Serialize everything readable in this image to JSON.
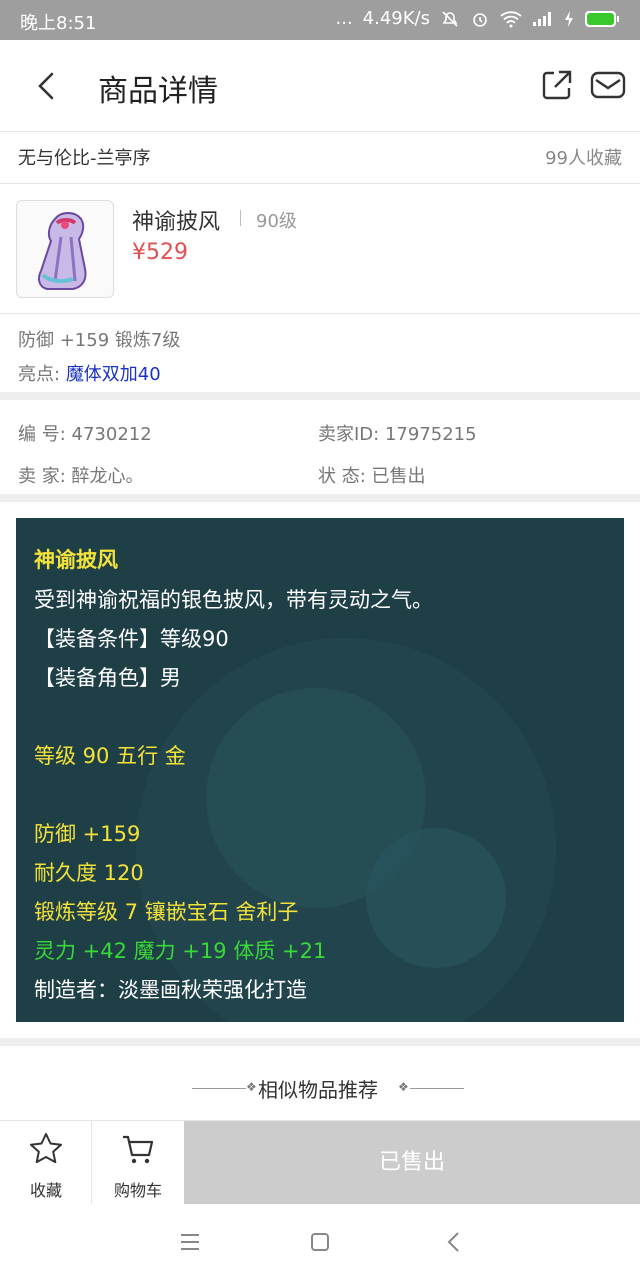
{
  "status_bar": {
    "time": "晚上8:51",
    "dots": "...",
    "speed": "4.49K/s"
  },
  "nav": {
    "title": "商品详情",
    "icons": [
      "back-icon",
      "share-icon",
      "mail-icon"
    ]
  },
  "product": {
    "name": "无与伦比-兰亭序",
    "fav_count": "99人收藏",
    "title": "神谕披风",
    "level": "90级",
    "price": "¥529",
    "attrs": "防御 +159 锻炼7级",
    "highlight_label": "亮点:",
    "highlight_value": "魔体双加40"
  },
  "meta": {
    "id_label": "编  号:",
    "id_value": "4730212",
    "seller_id_label": "卖家ID:",
    "seller_id_value": "17975215",
    "seller_label": "卖  家:",
    "seller_value": "醉龙心。",
    "status_label": "状  态:",
    "status_value": "已售出"
  },
  "description": {
    "title": "神谕披风",
    "line1": "受到神谕祝福的银色披风，带有灵动之气。",
    "line2": "【装备条件】等级90",
    "line3": "【装备角色】男",
    "line4": "等级 90  五行 金",
    "line5": "防御 +159",
    "line6": "耐久度 120",
    "line7": "锻炼等级 7  镶嵌宝石 舍利子",
    "line8": "灵力 +42 魔力 +19 体质 +21",
    "line9": "制造者：淡墨画秋荣强化打造"
  },
  "similar": {
    "label": "相似物品推荐"
  },
  "bottom_bar": {
    "fav_label": "收藏",
    "cart_label": "购物车",
    "sold_label": "已售出"
  },
  "colors": {
    "price": "#e05050",
    "highlight": "#1a33c4",
    "panel_bg": "#1f3f47",
    "text_yellow": "#f2e23a",
    "text_green": "#38d838",
    "sold_button": "#cccccc"
  }
}
